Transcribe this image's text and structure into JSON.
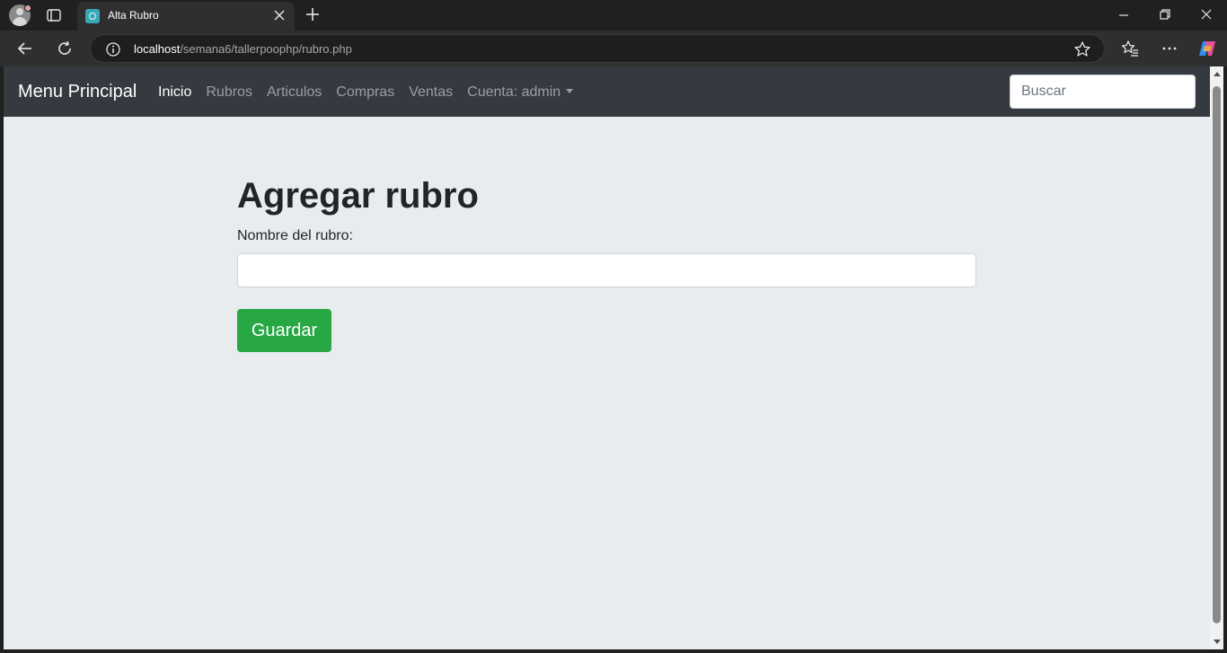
{
  "browser": {
    "tab_title": "Alta Rubro",
    "url_host": "localhost",
    "url_path": "/semana6/tallerpoophp/rubro.php",
    "icons": [
      "profile-icon",
      "tab-actions-icon",
      "favicon",
      "close-icon",
      "plus-icon",
      "minimize-icon",
      "restore-icon",
      "back-icon",
      "reload-icon",
      "info-icon",
      "star-icon",
      "favorites-icon",
      "more-icon",
      "copilot-icon"
    ]
  },
  "navbar": {
    "brand": "Menu Principal",
    "links": [
      {
        "label": "Inicio",
        "active": true
      },
      {
        "label": "Rubros",
        "active": false
      },
      {
        "label": "Articulos",
        "active": false
      },
      {
        "label": "Compras",
        "active": false
      },
      {
        "label": "Ventas",
        "active": false
      }
    ],
    "account_label": "Cuenta: admin",
    "search_placeholder": "Buscar"
  },
  "form": {
    "title": "Agregar rubro",
    "field_label": "Nombre del rubro:",
    "field_value": "",
    "submit_label": "Guardar"
  },
  "colors": {
    "navbar_bg": "#343a40",
    "page_bg": "#e9ecef",
    "primary_button": "#28a745"
  }
}
